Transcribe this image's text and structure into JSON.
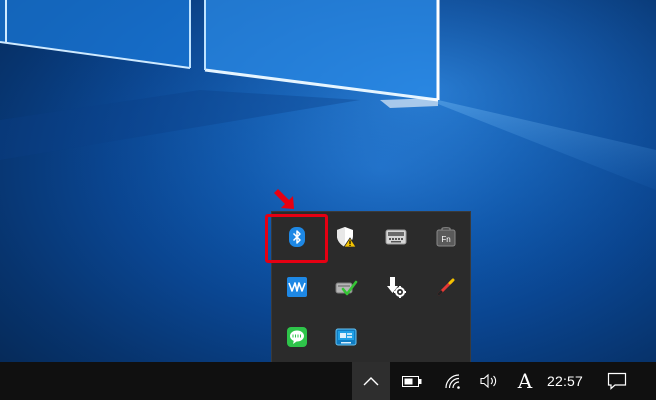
{
  "taskbar": {
    "clock_time": "22:57",
    "ime_indicator": "A"
  },
  "tray_overflow": {
    "icons": [
      {
        "name": "bluetooth-icon",
        "highlighted": true
      },
      {
        "name": "security-warning-icon"
      },
      {
        "name": "keyboard-icon"
      },
      {
        "name": "fn-lock-icon"
      },
      {
        "name": "audio-waves-icon"
      },
      {
        "name": "device-check-icon"
      },
      {
        "name": "mouse-settings-icon"
      },
      {
        "name": "pen-icon"
      },
      {
        "name": "line-chat-icon"
      },
      {
        "name": "network-monitor-icon"
      }
    ],
    "fn_label": "Fn"
  },
  "colors": {
    "highlight": "#e60012",
    "bluetooth": "#1e88e5",
    "taskbar": "#101010",
    "flyout": "#2b2b2b"
  }
}
